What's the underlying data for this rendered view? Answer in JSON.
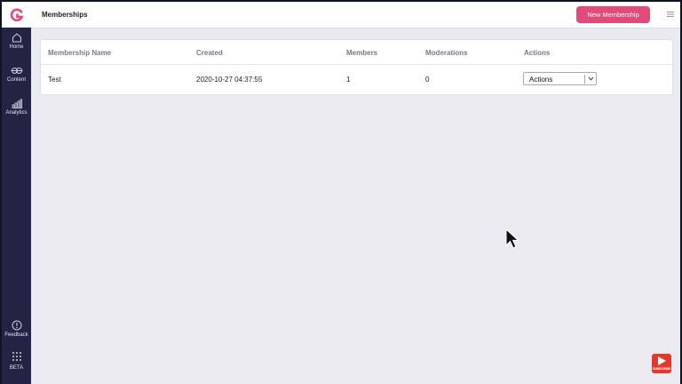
{
  "app": {
    "page_title": "Memberships",
    "new_button_label": "New Membership"
  },
  "sidebar": {
    "logo_icon": "brand-logo-icon",
    "items": [
      {
        "label": "Home",
        "icon": "home-icon"
      },
      {
        "label": "Content",
        "icon": "content-icon"
      },
      {
        "label": "Analytics",
        "icon": "analytics-icon"
      }
    ],
    "bottom_items": [
      {
        "label": "Feedback",
        "icon": "feedback-icon"
      },
      {
        "label": "BETA",
        "icon": "apps-grid-icon"
      }
    ]
  },
  "table": {
    "headers": [
      "Membership Name",
      "Created",
      "Members",
      "Moderations",
      "Actions"
    ],
    "rows": [
      {
        "name": "Test",
        "created": "2020-10-27 04:37:55",
        "members": "1",
        "moderations": "0",
        "actions_label": "Actions"
      }
    ]
  },
  "overlay": {
    "subscribe_label": "SUBSCRIBE"
  },
  "colors": {
    "sidebar": "#232343",
    "accent": "#e24a7a",
    "background": "#eceaf1"
  }
}
